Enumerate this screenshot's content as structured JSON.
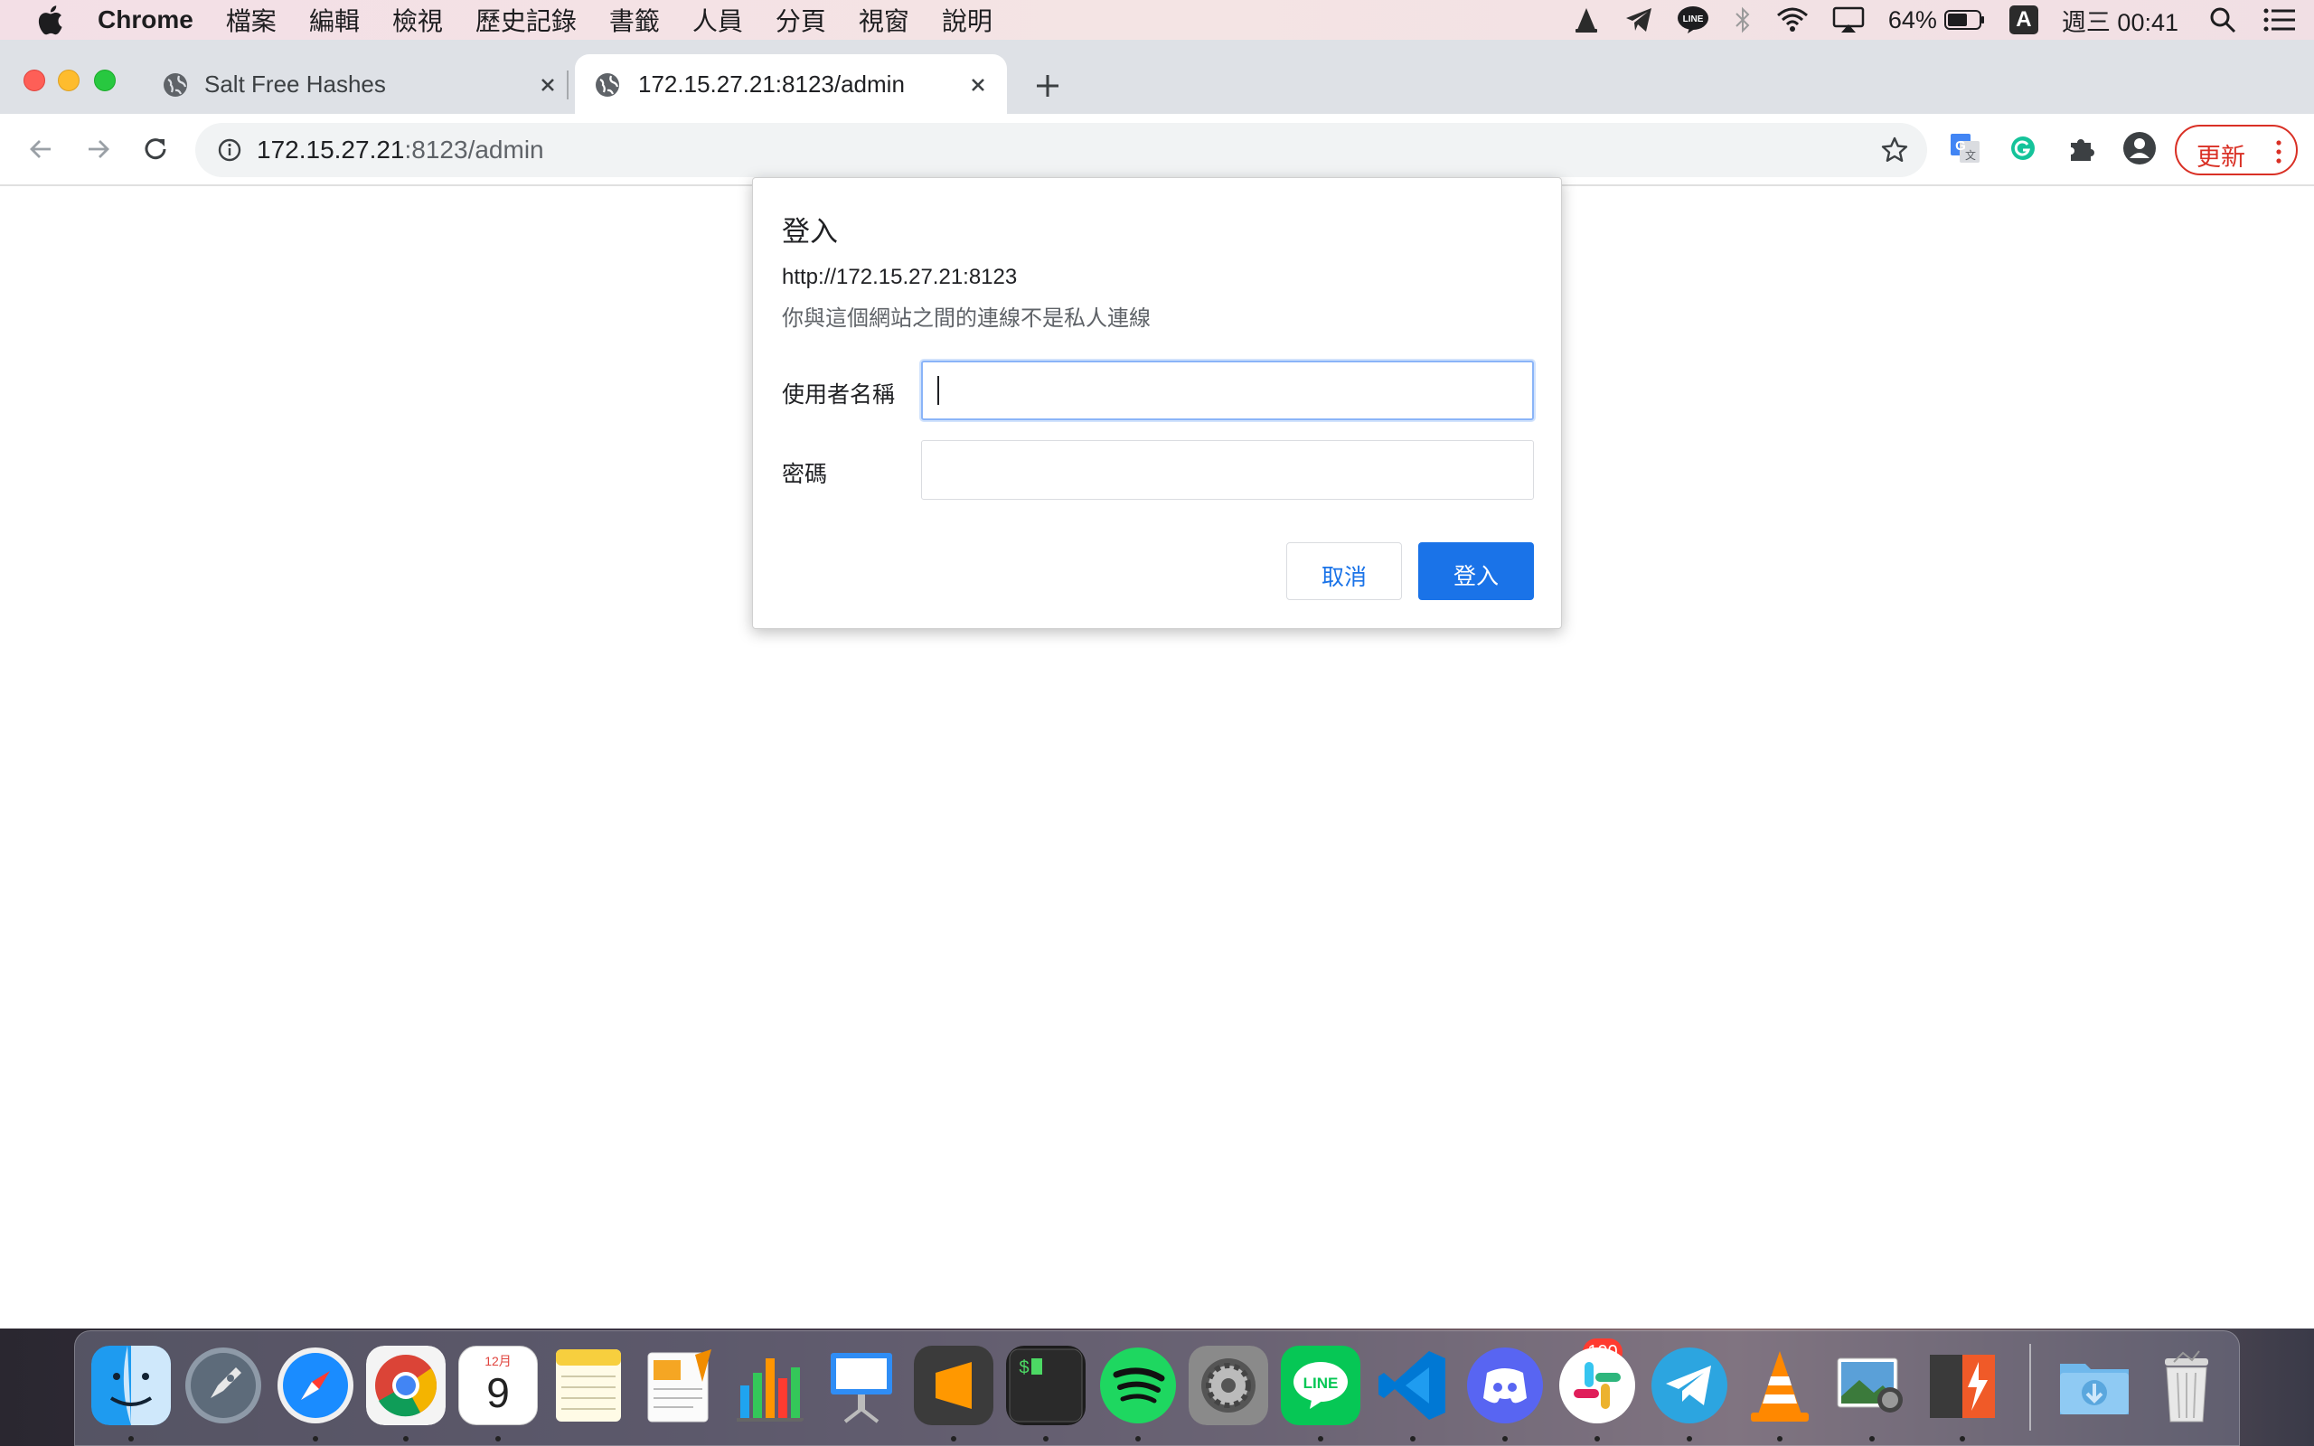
{
  "menubar": {
    "app_name": "Chrome",
    "menus": [
      "檔案",
      "編輯",
      "檢視",
      "歷史記錄",
      "書籤",
      "人員",
      "分頁",
      "視窗",
      "說明"
    ],
    "battery_percent": "64%",
    "input_source": "A",
    "clock": "週三 00:41",
    "status_icons": [
      "vlc-icon",
      "telegram-icon",
      "line-icon",
      "bluetooth-icon",
      "wifi-icon",
      "airplay-icon",
      "battery-icon",
      "input-source-icon",
      "search-icon",
      "list-icon"
    ]
  },
  "browser": {
    "tabs": [
      {
        "title": "Salt Free Hashes",
        "active": false
      },
      {
        "title": "172.15.27.21:8123/admin",
        "active": true
      }
    ],
    "url_host": "172.15.27.21",
    "url_rest": ":8123/admin",
    "update_label": "更新"
  },
  "dialog": {
    "title": "登入",
    "origin": "http://172.15.27.21:8123",
    "warning": "你與這個網站之間的連線不是私人連線",
    "username_label": "使用者名稱",
    "password_label": "密碼",
    "username_value": "",
    "password_value": "",
    "cancel_label": "取消",
    "login_label": "登入"
  },
  "dock": {
    "apps": [
      "Finder",
      "Launchpad",
      "Safari",
      "Chrome",
      "Calendar",
      "Notes",
      "Pages",
      "Numbers",
      "Keynote",
      "Sublime Text",
      "Terminal",
      "Spotify",
      "System Preferences",
      "LINE",
      "VS Code",
      "Discord",
      "Slack",
      "Telegram",
      "VLC",
      "Preview",
      "Flashback",
      "Downloads",
      "Trash"
    ],
    "calendar_month": "12月",
    "calendar_day": "9",
    "discord_badge": "100",
    "line_label": "LINE"
  },
  "colors": {
    "accent": "#1a73e8",
    "update_red": "#d93025",
    "tabstrip": "#dee1e6"
  }
}
